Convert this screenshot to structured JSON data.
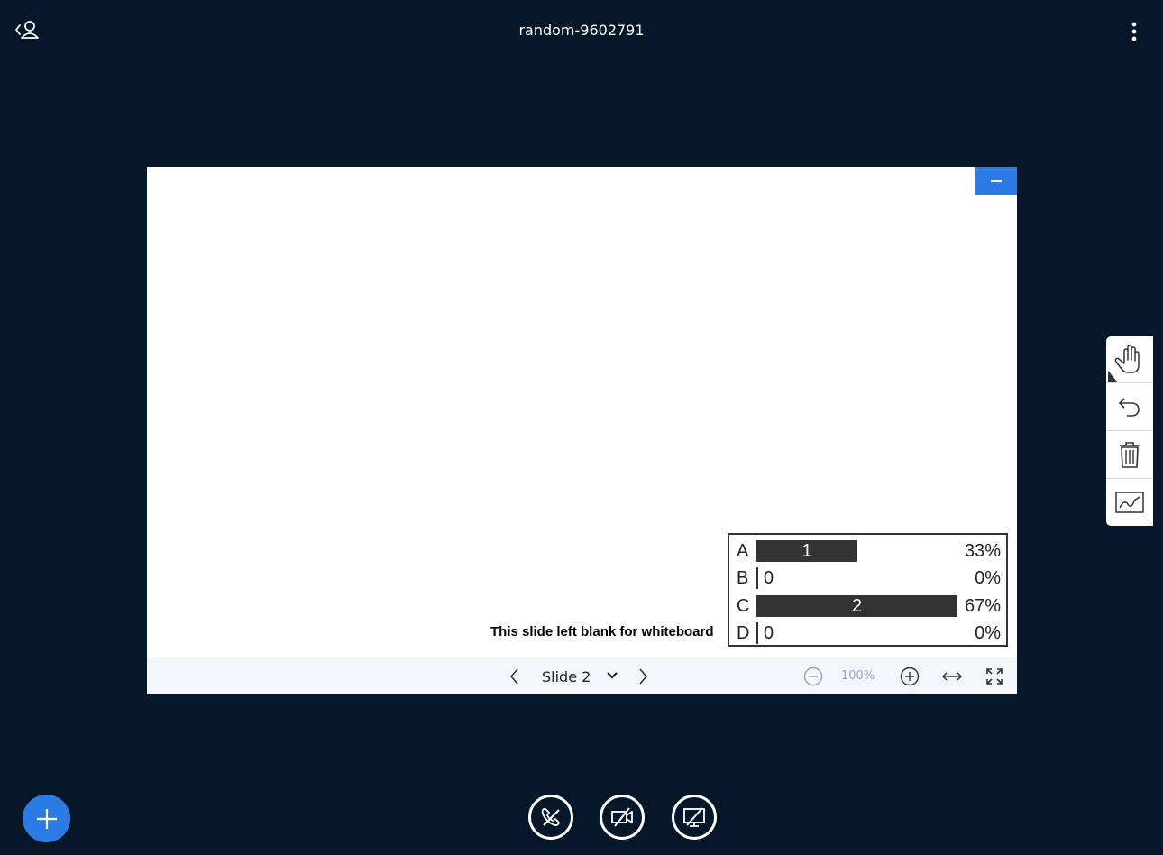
{
  "header": {
    "title": "random-9602791",
    "back_icon": "user-back-icon",
    "menu_icon": "kebab-menu-icon"
  },
  "presentation": {
    "minimize_icon": "minus-icon",
    "slide_caption": "This slide left blank for whiteboard",
    "poll": {
      "rows": [
        {
          "letter": "A",
          "count": "1",
          "percent": "33%",
          "fraction": 0.33
        },
        {
          "letter": "B",
          "count": "0",
          "percent": "0%",
          "fraction": 0
        },
        {
          "letter": "C",
          "count": "2",
          "percent": "67%",
          "fraction": 0.67
        },
        {
          "letter": "D",
          "count": "0",
          "percent": "0%",
          "fraction": 0
        }
      ]
    },
    "toolbar": {
      "slide_label": "Slide 2",
      "zoom_level": "100%"
    }
  },
  "whiteboard_tools": [
    {
      "name": "pan-hand-icon"
    },
    {
      "name": "undo-icon"
    },
    {
      "name": "trash-icon"
    },
    {
      "name": "multi-user-whiteboard-icon"
    }
  ],
  "bottom_controls": {
    "fab_icon": "plus-icon",
    "audio_icon": "phone-off-icon",
    "video_icon": "video-off-icon",
    "screenshare_icon": "screenshare-off-icon"
  },
  "colors": {
    "background": "#06172a",
    "accent": "#2c7be5",
    "bar": "#333333"
  }
}
